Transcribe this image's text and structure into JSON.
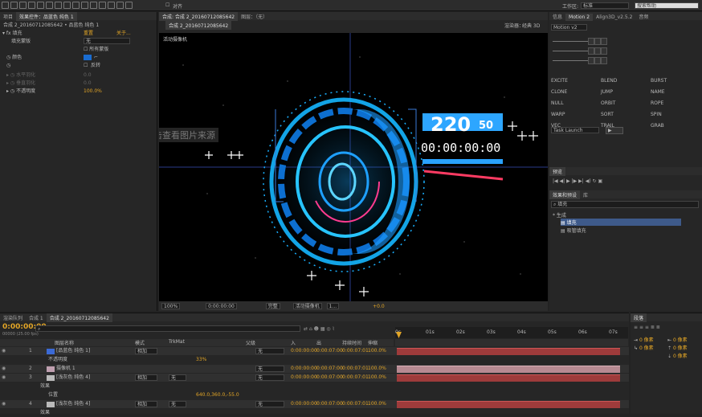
{
  "toolbar": {
    "snap_label": "对齐",
    "workspace_label": "工作区:",
    "workspace_value": "标准",
    "search_placeholder": "搜索帮助"
  },
  "effect_controls": {
    "tab_project": "项目",
    "tab_effect": "效果控件：品蓝色 纯色 1",
    "breadcrumb": "合成 2_20160712085642 • 品蓝色 纯色 1",
    "effect_name": "填充",
    "reset_label": "重置",
    "about_label": "关于...",
    "rows": [
      {
        "label": "填充蒙版",
        "value": "无"
      },
      {
        "label": "",
        "value": "所有蒙版"
      },
      {
        "label": "颜色",
        "value": ""
      },
      {
        "label": "",
        "value": "反转"
      },
      {
        "label": "水平羽化",
        "value": "0.0"
      },
      {
        "label": "垂直羽化",
        "value": "0.0"
      },
      {
        "label": "不透明度",
        "value": "100.0%"
      }
    ]
  },
  "composition": {
    "tab_comp": "合成: 合成 2_20160712085642",
    "tab_layer": "图层：（无）",
    "comp_chip": "合成 2_20160712085642",
    "renderer_label": "渲染器：",
    "renderer_value": "经典 3D",
    "camera_label": "活动摄像机",
    "watermark": "点击查看图片来源",
    "hud_number": "220",
    "hud_small": "50",
    "hud_timecode": "00:00:00:00",
    "footer": {
      "zoom": "100%",
      "timecode": "0:00:00:00",
      "resolution": "完整",
      "view": "活动摄像机",
      "views": "1...",
      "exposure": "+0.0"
    }
  },
  "right_panels": {
    "info_tab": "信息",
    "motion_tab": "Motion 2",
    "align_tab": "Align3D_v2.5.2",
    "audio_tab": "音频",
    "motion_version": "Motion v2",
    "motion_buttons": [
      [
        "EXCITE",
        "BLEND",
        "BURST"
      ],
      [
        "CLONE",
        "JUMP",
        "NAME"
      ],
      [
        "NULL",
        "ORBIT",
        "ROPE"
      ],
      [
        "WARP",
        "SORT",
        "SPIN"
      ],
      [
        "VEC",
        "TRAIL",
        "GRAB"
      ]
    ],
    "task_select": "Task Launch",
    "preview_tab": "预览",
    "effects_tab": "效果和预设",
    "library_tab": "库",
    "search_value": "填充",
    "tree_root": "* 生成",
    "tree_items": [
      "填充",
      "吸管填充"
    ],
    "paragraph_tab": "段落",
    "para_values": [
      "0 像素",
      "0 像素",
      "0 像素",
      "0 像素",
      "0 像素"
    ]
  },
  "timeline": {
    "tab_render": "渲染队列",
    "tab_comp1": "合成 1",
    "tab_comp2": "合成 2_20160712085642",
    "current_time": "0:00:00:00",
    "fps": "00000 (25.00 fps)",
    "columns": {
      "name": "图层名称",
      "mode": "模式",
      "trkmat": "TrkMat",
      "parent": "父级",
      "in": "入",
      "out": "出",
      "duration": "持续时间",
      "stretch": "伸缩"
    },
    "ruler": [
      "0s",
      "01s",
      "02s",
      "03s",
      "04s",
      "05s",
      "06s",
      "07s"
    ],
    "layers": [
      {
        "num": "1",
        "name": "[品蓝色 纯色 1]",
        "mode": "相加",
        "trkmat": "",
        "parent": "无",
        "in": "0:00:00:00",
        "out": "0:00:07:00",
        "dur": "0:00:07:01",
        "stretch": "100.0%",
        "color": "#3b6ad6"
      },
      {
        "sub": "不透明度",
        "value": "33%"
      },
      {
        "num": "2",
        "name": "摄像机 1",
        "mode": "",
        "trkmat": "",
        "parent": "无",
        "in": "0:00:00:00",
        "out": "0:00:07:00",
        "dur": "0:00:07:01",
        "stretch": "100.0%",
        "color": "#c0a0b0"
      },
      {
        "num": "3",
        "name": "[浅灰色 纯色 4]",
        "mode": "相加",
        "trkmat": "无",
        "parent": "无",
        "in": "0:00:00:00",
        "out": "0:00:07:00",
        "dur": "0:00:07:01",
        "stretch": "100.0%",
        "color": "#bbbbbb"
      },
      {
        "sub": "效果",
        "value": ""
      },
      {
        "sub": "位置",
        "value": "640.0,360.0,-55.0"
      },
      {
        "num": "4",
        "name": "[浅灰色 纯色 4]",
        "mode": "相加",
        "trkmat": "无",
        "parent": "无",
        "in": "0:00:00:00",
        "out": "0:00:07:00",
        "dur": "0:00:07:01",
        "stretch": "100.0%",
        "color": "#bbbbbb"
      },
      {
        "sub": "效果",
        "value": ""
      }
    ]
  },
  "colors": {
    "accent": "#e2a526",
    "hud_blue": "#16b8ff",
    "hud_red": "#ff3b63",
    "panel_bg": "#232323"
  }
}
